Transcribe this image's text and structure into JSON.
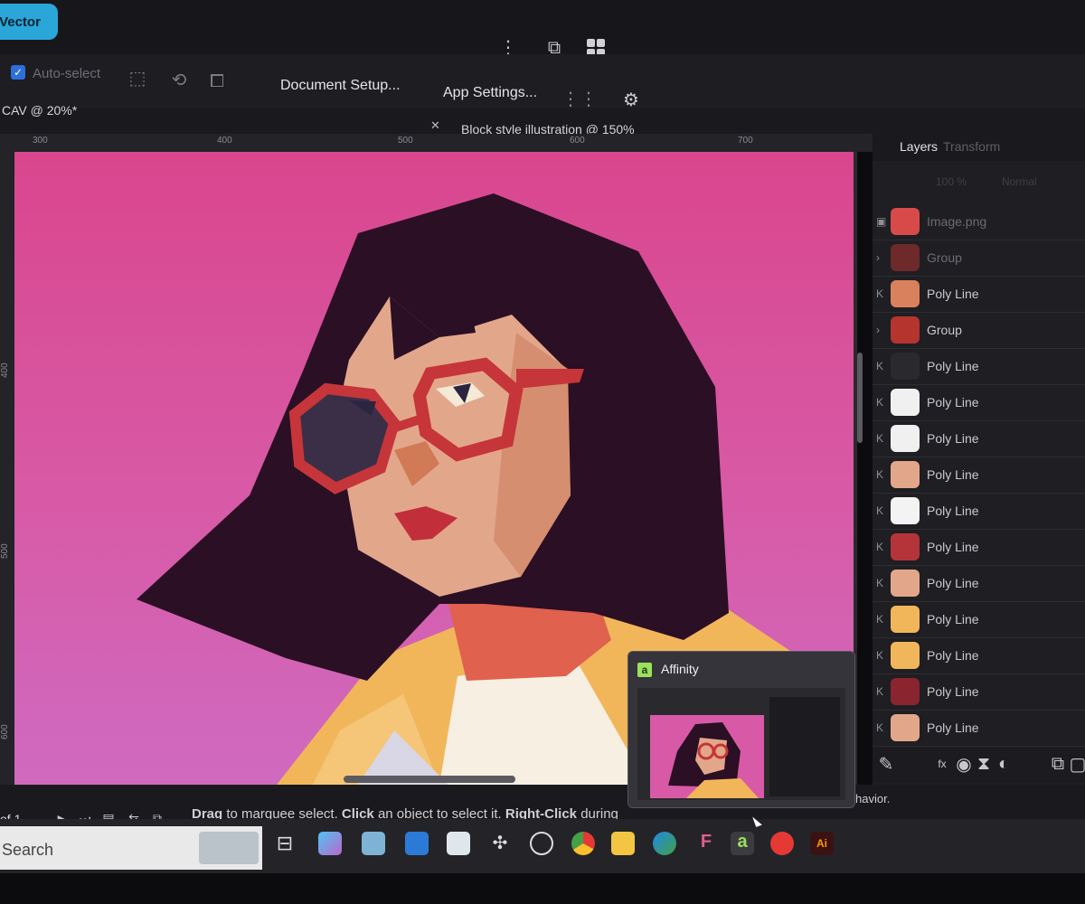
{
  "persona_label": "Vector",
  "context_toolbar": {
    "auto_select_label": "Auto-select",
    "document_setup_label": "Document Setup...",
    "app_settings_label": "App Settings..."
  },
  "tabs": [
    {
      "label": "CAV @ 20%*"
    },
    {
      "label": "Block style illustration @ 150%"
    }
  ],
  "ruler": {
    "h_ticks": [
      "300",
      "400",
      "500",
      "600",
      "700"
    ],
    "v_ticks": [
      "400",
      "500",
      "600"
    ]
  },
  "layers_panel": {
    "tabs": [
      "Layers",
      "Transform"
    ],
    "opacity": "100 %",
    "blend": "Normal",
    "layers": [
      {
        "name": "Image.png"
      },
      {
        "name": "Group"
      },
      {
        "name": "Poly Line"
      },
      {
        "name": "Group"
      },
      {
        "name": "Poly Line"
      },
      {
        "name": "Poly Line"
      },
      {
        "name": "Poly Line"
      },
      {
        "name": "Poly Line"
      },
      {
        "name": "Poly Line"
      },
      {
        "name": "Poly Line"
      },
      {
        "name": "Poly Line"
      },
      {
        "name": "Poly Line"
      },
      {
        "name": "Poly Line"
      },
      {
        "name": "Poly Line"
      },
      {
        "name": "Poly Line"
      }
    ]
  },
  "status": {
    "page": "of 1",
    "drag": "Drag",
    "drag_rest": " to marquee select. ",
    "click": "Click",
    "click_rest": " an object to select it. ",
    "right_click": "Right-Click",
    "right_click_rest": " during",
    "tail": "havior."
  },
  "taskbar": {
    "search_placeholder": "Search",
    "preview_title": "Affinity",
    "ai_label": "Ai"
  },
  "colors": {
    "artboard_top": "#d9468e",
    "artboard_bottom": "#cf6ac0",
    "hair": "#2a0e24",
    "skin": "#e2a78a",
    "glasses": "#c6353a",
    "persona_accent": "#2aa6d9"
  }
}
